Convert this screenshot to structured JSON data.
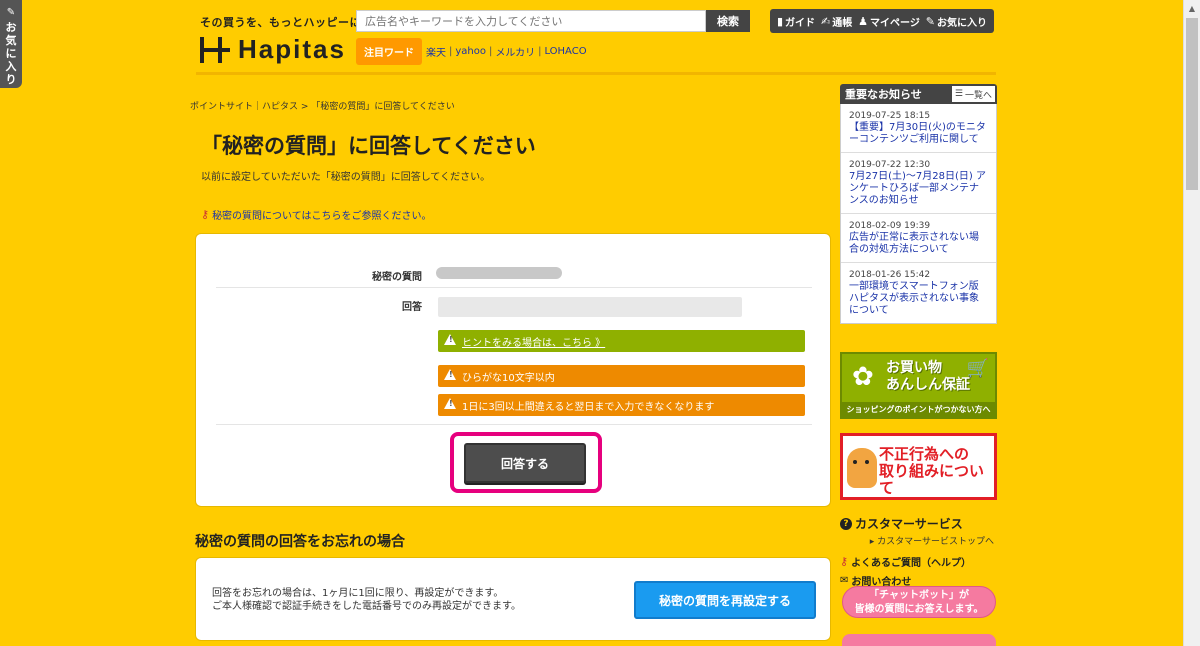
{
  "fav_tab": {
    "label": [
      "お",
      "気",
      "に",
      "入",
      "り"
    ]
  },
  "header": {
    "tagline": "その買うを、もっとハッピーに。",
    "logo": "Hapitas",
    "search": {
      "placeholder": "広告名やキーワードを入力してください",
      "button": "検索"
    },
    "hot_words": {
      "badge": "注目ワード",
      "items": [
        "楽天",
        "yahoo",
        "メルカリ",
        "LOHACO"
      ]
    },
    "nav": [
      {
        "icon": "guide-icon",
        "label": "ガイド"
      },
      {
        "icon": "passbook-icon",
        "label": "通帳"
      },
      {
        "icon": "user-icon",
        "label": "マイページ"
      },
      {
        "icon": "favorite-icon",
        "label": "お気に入り"
      }
    ]
  },
  "breadcrumb": {
    "home": "ポイントサイト｜ハピタス",
    "sep": ">",
    "current": "「秘密の質問」に回答してください"
  },
  "page": {
    "title": "「秘密の質問」に回答してください",
    "lead": "以前に設定していただいた「秘密の質問」に回答してください。",
    "help_link": "秘密の質問についてはこちらをご参照ください。"
  },
  "form": {
    "question_label": "秘密の質問",
    "answer_label": "回答",
    "hint": "ヒントをみる場合は、こちら 》",
    "notice1": "ひらがな10文字以内",
    "notice2": "1日に3回以上間違えると翌日まで入力できなくなります",
    "submit": "回答する"
  },
  "forgot": {
    "title": "秘密の質問の回答をお忘れの場合",
    "line1": "回答をお忘れの場合は、1ヶ月に1回に限り、再設定ができます。",
    "line2": "ご本人様確認で認証手続きをした電話番号でのみ再設定ができます。",
    "button": "秘密の質問を再設定する"
  },
  "sidebar": {
    "news_title": "重要なお知らせ",
    "news_more": "一覧へ",
    "news": [
      {
        "date": "2019-07-25 18:15",
        "text": "【重要】7月30日(火)のモニターコンテンツご利用に関して"
      },
      {
        "date": "2019-07-22 12:30",
        "text": "7月27日(土)〜7月28日(日) アンケートひろば一部メンテナンスのお知らせ"
      },
      {
        "date": "2018-02-09 19:39",
        "text": "広告が正常に表示されない場合の対処方法について"
      },
      {
        "date": "2018-01-26 15:42",
        "text": "一部環境でスマートフォン版ハピタスが表示されない事象について"
      }
    ],
    "banner_shopping": {
      "main1": "お買い物",
      "main2": "あんしん保証",
      "sub": "ショッピングのポイントがつかない方へ"
    },
    "banner_fraud": {
      "main1": "不正行為への",
      "main2": "取り組みについて"
    },
    "cs_title": "カスタマーサービス",
    "cs_top": "カスタマーサービストップへ",
    "faq": "よくあるご質問（ヘルプ）",
    "contact": "お問い合わせ",
    "chatbot1": "「チャットボット」が",
    "chatbot2": "皆様の質問にお答えします。"
  }
}
